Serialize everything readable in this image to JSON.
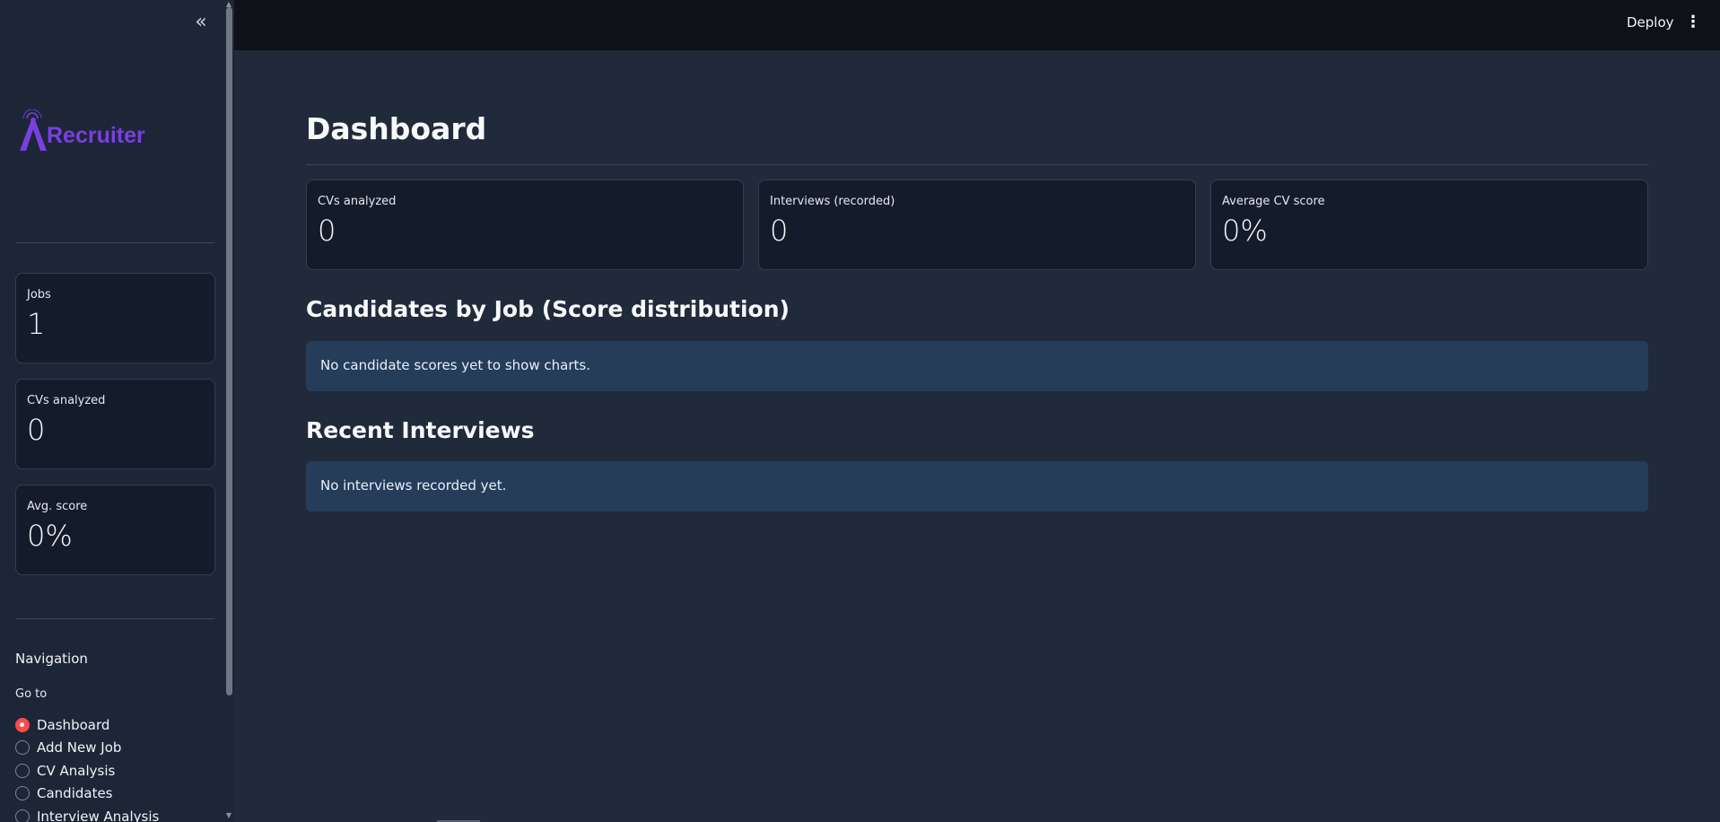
{
  "sidebar": {
    "collapse_icon": "«",
    "logo_text": "Recruiter",
    "metrics": [
      {
        "label": "Jobs",
        "value": "1"
      },
      {
        "label": "CVs analyzed",
        "value": "0"
      },
      {
        "label": "Avg. score",
        "value": "0%"
      }
    ],
    "navigation_title": "Navigation",
    "goto_label": "Go to",
    "nav_items": [
      {
        "label": "Dashboard",
        "selected": true
      },
      {
        "label": "Add New Job",
        "selected": false
      },
      {
        "label": "CV Analysis",
        "selected": false
      },
      {
        "label": "Candidates",
        "selected": false
      },
      {
        "label": "Interview Analysis",
        "selected": false
      }
    ]
  },
  "topbar": {
    "deploy_label": "Deploy",
    "menu_icon": "⋮"
  },
  "main": {
    "title": "Dashboard",
    "metrics": [
      {
        "label": "CVs analyzed",
        "value": "0"
      },
      {
        "label": "Interviews (recorded)",
        "value": "0"
      },
      {
        "label": "Average CV score",
        "value": "0%"
      }
    ],
    "candidates_section": {
      "title": "Candidates by Job (Score distribution)",
      "info": "No candidate scores yet to show charts."
    },
    "interviews_section": {
      "title": "Recent Interviews",
      "info": "No interviews recorded yet."
    }
  },
  "colors": {
    "accent": "#ff4b4b",
    "brand_purple": "#7a3fe0",
    "info_bg": "#263d5a"
  }
}
